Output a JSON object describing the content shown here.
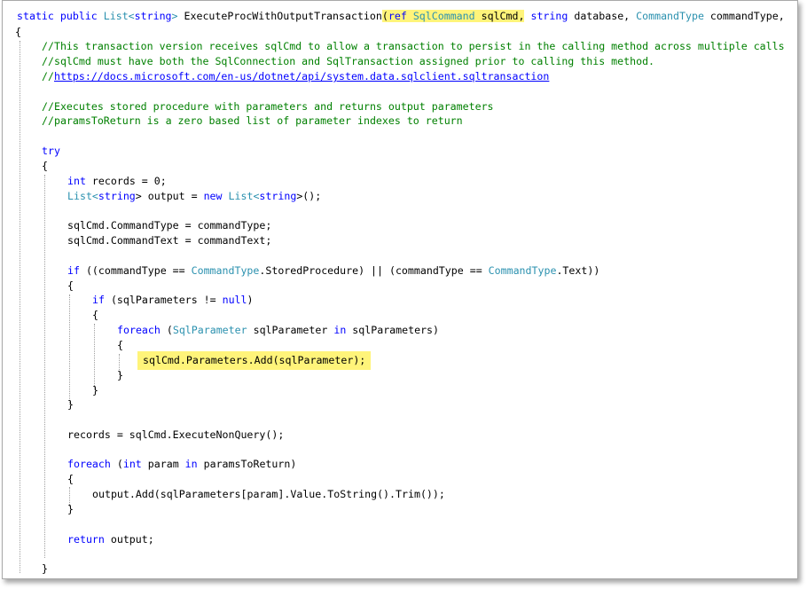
{
  "code": {
    "signature": {
      "kw_static": "static",
      "kw_public": "public",
      "type_list": "List",
      "lt": "<",
      "kw_string": "string",
      "gt": ">",
      "method": "ExecuteProcWithOutputTransaction",
      "paren_open": "(",
      "kw_ref": "ref",
      "type_sqlcommand": "SqlCommand",
      "param_sqlcmd": "sqlCmd,",
      "kw_string2": "string",
      "param_database": "database,",
      "type_commandtype": "CommandType",
      "param_commandtype": "commandType,"
    },
    "brace_open": "{",
    "brace_close": "}",
    "comments": {
      "c1": "//This transaction version receives sqlCmd to allow a transaction to persist in the calling method across multiple calls",
      "c2": "//sqlCmd must have both the SqlConnection and SqlTransaction assigned prior to calling this method.",
      "c3_prefix": "//",
      "c3_link": "https://docs.microsoft.com/en-us/dotnet/api/system.data.sqlclient.sqltransaction",
      "c4": "//Executes stored procedure with parameters and returns output parameters",
      "c5": "//paramsToReturn is a zero based list of parameter indexes to return"
    },
    "kw_try": "try",
    "records_decl": {
      "kw_int": "int",
      "rest": " records = 0;"
    },
    "output_decl": {
      "type_list": "List",
      "lt": "<",
      "kw_string": "string",
      "mid": "> output = ",
      "kw_new": "new",
      "type_list2": "List",
      "lt2": "<",
      "kw_string2": "string",
      "end": ">();"
    },
    "assign_commandtype": "sqlCmd.CommandType = commandType;",
    "assign_commandtext": "sqlCmd.CommandText = commandText;",
    "if_commandtype": {
      "kw_if": "if",
      "part1": " ((commandType == ",
      "type1": "CommandType",
      "part2": ".StoredProcedure) || (commandType == ",
      "type2": "CommandType",
      "part3": ".Text))"
    },
    "if_params": {
      "kw_if": "if",
      "part1": " (sqlParameters != ",
      "kw_null": "null",
      "part2": ")"
    },
    "foreach_params": {
      "kw_foreach": "foreach",
      "part1": " (",
      "type": "SqlParameter",
      "part2": " sqlParameter ",
      "kw_in": "in",
      "part3": " sqlParameters)"
    },
    "add_param": "sqlCmd.Parameters.Add(sqlParameter);",
    "execute": "records = sqlCmd.ExecuteNonQuery();",
    "foreach_return": {
      "kw_foreach": "foreach",
      "part1": " (",
      "kw_int": "int",
      "part2": " param ",
      "kw_in": "in",
      "part3": " paramsToReturn)"
    },
    "output_add": "output.Add(sqlParameters[param].Value.ToString().Trim());",
    "return_stmt": {
      "kw_return": "return",
      "rest": " output;"
    }
  },
  "colors": {
    "keyword": "#0000ff",
    "type": "#2b91af",
    "comment": "#008000",
    "highlight": "#fff47a"
  }
}
